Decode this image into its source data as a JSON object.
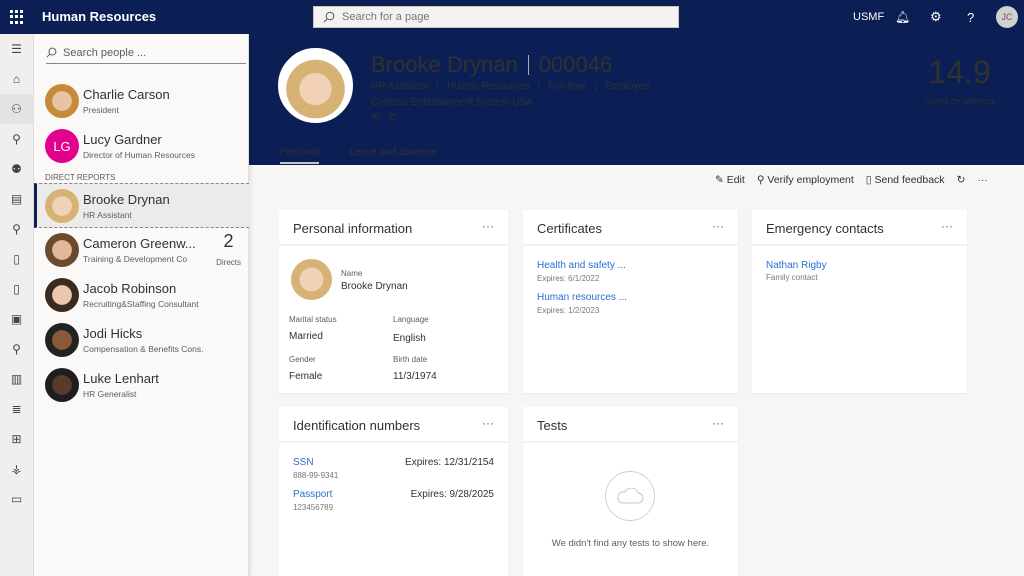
{
  "app": {
    "title": "Human Resources",
    "search_placeholder": "Search for a page",
    "company": "USMF",
    "user_initials": "JC"
  },
  "people": {
    "search_placeholder": "Search people ...",
    "section_label": "DIRECT REPORTS",
    "managers": [
      {
        "name": "Charlie Carson",
        "role": "President"
      },
      {
        "name": "Lucy Gardner",
        "role": "Director of Human Resources",
        "initials": "LG"
      }
    ],
    "reports": [
      {
        "name": "Brooke Drynan",
        "role": "HR Assistant",
        "selected": true
      },
      {
        "name": "Cameron Greenw...",
        "role": "Training & Development Co",
        "directs_count": "2",
        "directs_label": "Directs"
      },
      {
        "name": "Jacob Robinson",
        "role": "Recruiting&Staffing Consultant"
      },
      {
        "name": "Jodi Hicks",
        "role": "Compensation & Benefits Cons."
      },
      {
        "name": "Luke Lenhart",
        "role": "HR Generalist"
      }
    ]
  },
  "employee": {
    "name": "Brooke Drynan",
    "id": "000046",
    "title": "HR Assistant",
    "department": "Human Resources",
    "type": "Full-time",
    "category": "Employee",
    "company": "Contoso Entertainment System USA",
    "years": "14.9",
    "years_label": "YEARS OF SERVICE"
  },
  "tabs": [
    "Personal",
    "Leave and absence"
  ],
  "toolbar": {
    "edit": "Edit",
    "verify": "Verify employment",
    "feedback": "Send feedback"
  },
  "personal": {
    "title": "Personal information",
    "name_label": "Name",
    "name": "Brooke Drynan",
    "marital_label": "Marital status",
    "marital": "Married",
    "language_label": "Language",
    "language": "English",
    "gender_label": "Gender",
    "gender": "Female",
    "birth_label": "Birth date",
    "birth": "11/3/1974"
  },
  "certificates": {
    "title": "Certificates",
    "items": [
      {
        "name": "Health and safety ...",
        "expires": "Expires: 6/1/2022"
      },
      {
        "name": "Human resources ...",
        "expires": "Expires: 1/2/2023"
      }
    ]
  },
  "emergency": {
    "title": "Emergency contacts",
    "name": "Nathan Rigby",
    "relation": "Family contact"
  },
  "identification": {
    "title": "Identification numbers",
    "items": [
      {
        "type": "SSN",
        "number": "888-99-9341",
        "expires": "Expires: 12/31/2154"
      },
      {
        "type": "Passport",
        "number": "123456789",
        "expires": "Expires: 9/28/2025"
      }
    ]
  },
  "tests": {
    "title": "Tests",
    "empty": "We didn't find any tests to show here."
  },
  "colors": {
    "header": "#0c1f55",
    "link": "#2b6fd1",
    "lucy_avatar": "#e3008c"
  }
}
